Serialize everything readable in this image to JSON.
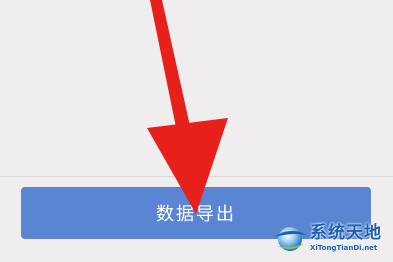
{
  "export_button": {
    "label": "数据导出"
  },
  "watermark": {
    "title": "系统天地",
    "url": "XiTongTianDi.net"
  },
  "colors": {
    "background": "#f0edee",
    "button": "#5a85d2",
    "arrow": "#e8201c",
    "watermark": "#1b5fb0"
  },
  "icons": {
    "arrow": "red-pointer-arrow-icon",
    "logo": "globe-logo-icon"
  }
}
